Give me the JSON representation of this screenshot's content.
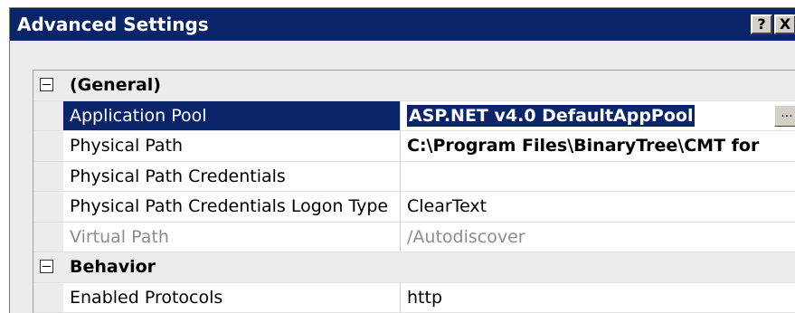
{
  "window": {
    "title": "Advanced Settings",
    "help_button": "?",
    "close_button": "X"
  },
  "grid": {
    "categories": [
      {
        "label": "(General)",
        "properties": [
          {
            "name": "Application Pool",
            "value": "ASP.NET v4.0 DefaultAppPool",
            "selected": true,
            "has_ellipsis": true,
            "ellipsis_label": "..."
          },
          {
            "name": "Physical Path",
            "value": "C:\\Program Files\\BinaryTree\\CMT for",
            "bold": true
          },
          {
            "name": "Physical Path Credentials",
            "value": ""
          },
          {
            "name": "Physical Path Credentials Logon Type",
            "value": "ClearText"
          },
          {
            "name": "Virtual Path",
            "value": "/Autodiscover",
            "disabled": true
          }
        ]
      },
      {
        "label": "Behavior",
        "properties": [
          {
            "name": "Enabled Protocols",
            "value": "http"
          }
        ]
      }
    ]
  },
  "colors": {
    "selection": "#0a246a",
    "titlebar": "#0a246a",
    "disabled_text": "#8c8c8c",
    "category_bg": "#ececec"
  }
}
